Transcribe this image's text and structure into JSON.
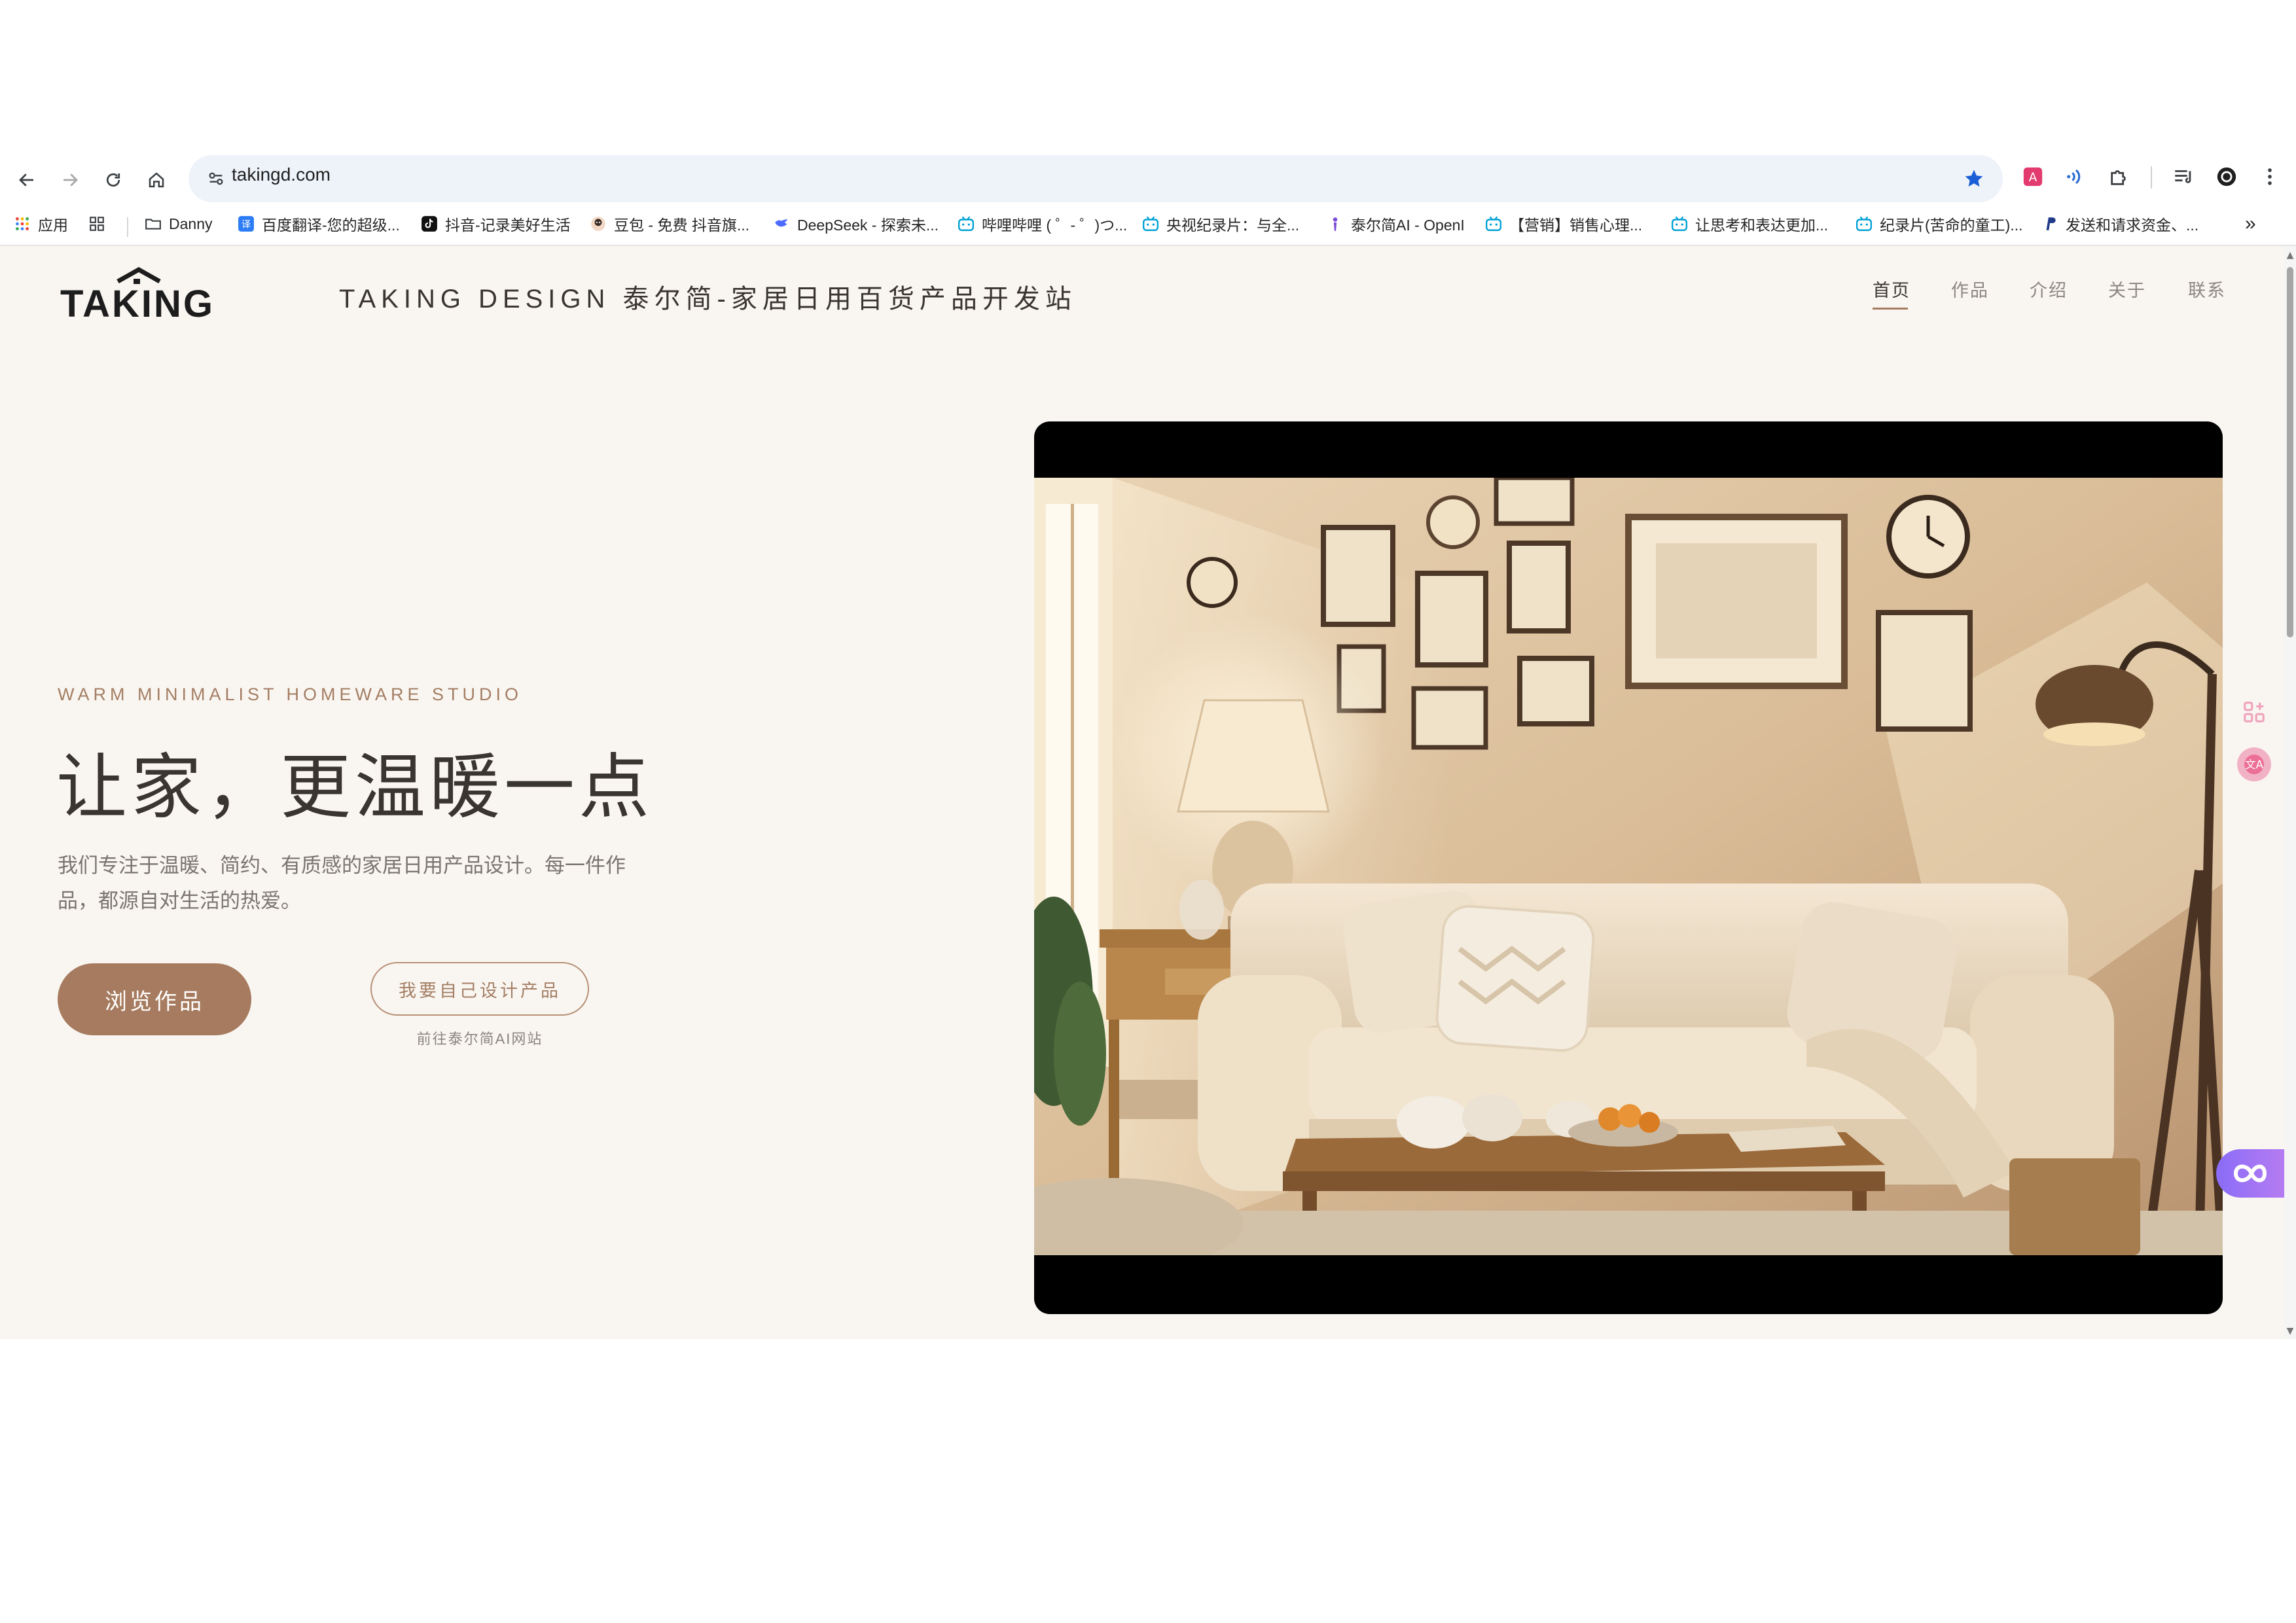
{
  "browser": {
    "url": "takingd.com",
    "bookmarks": [
      {
        "label": "应用",
        "icon": "apps-grid-icon"
      },
      {
        "label": "",
        "icon": "tab-groups-icon"
      },
      {
        "label": "Danny",
        "icon": "folder-icon"
      },
      {
        "label": "百度翻译-您的超级...",
        "icon": "baidu-translate-icon"
      },
      {
        "label": "抖音-记录美好生活",
        "icon": "douyin-icon"
      },
      {
        "label": "豆包 - 免费 抖音旗...",
        "icon": "doubao-icon"
      },
      {
        "label": "DeepSeek - 探索未...",
        "icon": "deepseek-icon"
      },
      {
        "label": "哔哩哔哩 ( ゜- ゜)つ...",
        "icon": "bilibili-icon"
      },
      {
        "label": "央视纪录片：与全...",
        "icon": "bilibili-icon"
      },
      {
        "label": "泰尔简AI - OpenI",
        "icon": "openai-icon"
      },
      {
        "label": "【营销】销售心理...",
        "icon": "bilibili-icon"
      },
      {
        "label": "让思考和表达更加...",
        "icon": "bilibili-icon"
      },
      {
        "label": "纪录片(苦命的童工)...",
        "icon": "bilibili-icon"
      },
      {
        "label": "发送和请求资金、...",
        "icon": "paypal-icon"
      }
    ]
  },
  "site": {
    "logo_text": "TAKING",
    "title": "TAKING DESIGN 泰尔简-家居日用百货产品开发站",
    "nav": [
      {
        "label": "首页",
        "active": true
      },
      {
        "label": "作品",
        "active": false
      },
      {
        "label": "介绍",
        "active": false
      },
      {
        "label": "关于",
        "active": false
      },
      {
        "label": "联系",
        "active": false
      }
    ]
  },
  "hero": {
    "eyebrow": "WARM MINIMALIST HOMEWARE STUDIO",
    "headline": "让家，更温暖一点",
    "description": "我们专注于温暖、简约、有质感的家居日用产品设计。每一件作品，都源自对生活的热爱。",
    "primary_button": "浏览作品",
    "secondary_button": "我要自己设计产品",
    "secondary_note": "前往泰尔简AI网站",
    "image_alt": "warm living room with sofa, lamp and picture frames"
  },
  "colors": {
    "accent": "#a67b5f",
    "page_bg": "#f9f6f1",
    "text_dark": "#3a3532",
    "text_muted": "#7b7470"
  }
}
